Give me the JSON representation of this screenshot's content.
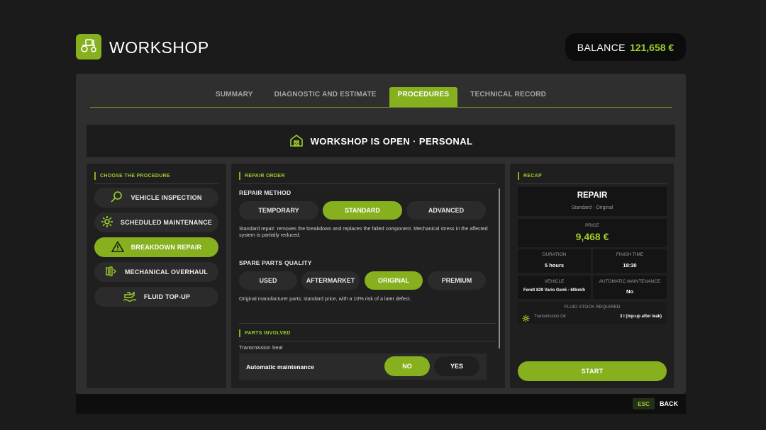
{
  "header": {
    "title": "WORKSHOP",
    "logo_icon": "tractor-icon"
  },
  "balance": {
    "label": "BALANCE",
    "value": "121,658 €"
  },
  "tabs": [
    {
      "label": "SUMMARY",
      "active": false
    },
    {
      "label": "DIAGNOSTIC AND ESTIMATE",
      "active": false
    },
    {
      "label": "PROCEDURES",
      "active": true
    },
    {
      "label": "TECHNICAL RECORD",
      "active": false
    }
  ],
  "banner": {
    "icon": "barn-icon",
    "text": "WORKSHOP IS OPEN · PERSONAL"
  },
  "procedures": {
    "title": "CHOOSE THE PROCEDURE",
    "items": [
      {
        "label": "VEHICLE INSPECTION",
        "icon": "magnifier-icon",
        "active": false
      },
      {
        "label": "SCHEDULED MAINTENANCE",
        "icon": "gear-icon",
        "active": false
      },
      {
        "label": "BREAKDOWN REPAIR",
        "icon": "warning-icon",
        "active": true
      },
      {
        "label": "MECHANICAL OVERHAUL",
        "icon": "engine-icon",
        "active": false
      },
      {
        "label": "FLUID TOP-UP",
        "icon": "oil-can-icon",
        "active": false
      }
    ]
  },
  "repair_order": {
    "title": "REPAIR ORDER",
    "method_label": "REPAIR METHOD",
    "methods": [
      "TEMPORARY",
      "STANDARD",
      "ADVANCED"
    ],
    "method_selected": "STANDARD",
    "method_desc": "Standard repair: removes the breakdown and replaces the failed component. Mechanical stress in the affected system is partially reduced.",
    "quality_label": "SPARE PARTS QUALITY",
    "qualities": [
      "USED",
      "AFTERMARKET",
      "ORIGINAL",
      "PREMIUM"
    ],
    "quality_selected": "ORIGINAL",
    "quality_desc": "Original manufacturer parts: standard price, with a 10% risk of a later defect.",
    "parts_title": "PARTS INVOLVED",
    "parts": [
      "Transmission Seal"
    ],
    "auto_maintenance": {
      "label": "Automatic maintenance",
      "no": "NO",
      "yes": "YES",
      "selected": "NO"
    }
  },
  "recap": {
    "title": "RECAP",
    "heading": "REPAIR",
    "subheading": "Standard · Original",
    "price_label": "PRICE",
    "price": "9,468 €",
    "duration_label": "DURATION",
    "duration": "5 hours",
    "finish_label": "FINISH TIME",
    "finish": "18:30",
    "vehicle_label": "VEHICLE",
    "vehicle": "Fendt 829 Vario Gen5 - 60km/h",
    "auto_label": "AUTOMATIC MAINTENANCE",
    "auto": "No",
    "fluid_label": "FLUID STOCK REQUIRED",
    "fluid_name": "Transmission Oil",
    "fluid_amount": "3 l (top-up after leak)",
    "start_label": "START"
  },
  "footer": {
    "key": "ESC",
    "label": "BACK"
  },
  "colors": {
    "accent": "#86b01e",
    "accent_text": "#9dcc2b",
    "panel": "#2e2f2e",
    "background": "#1b1b1b"
  }
}
